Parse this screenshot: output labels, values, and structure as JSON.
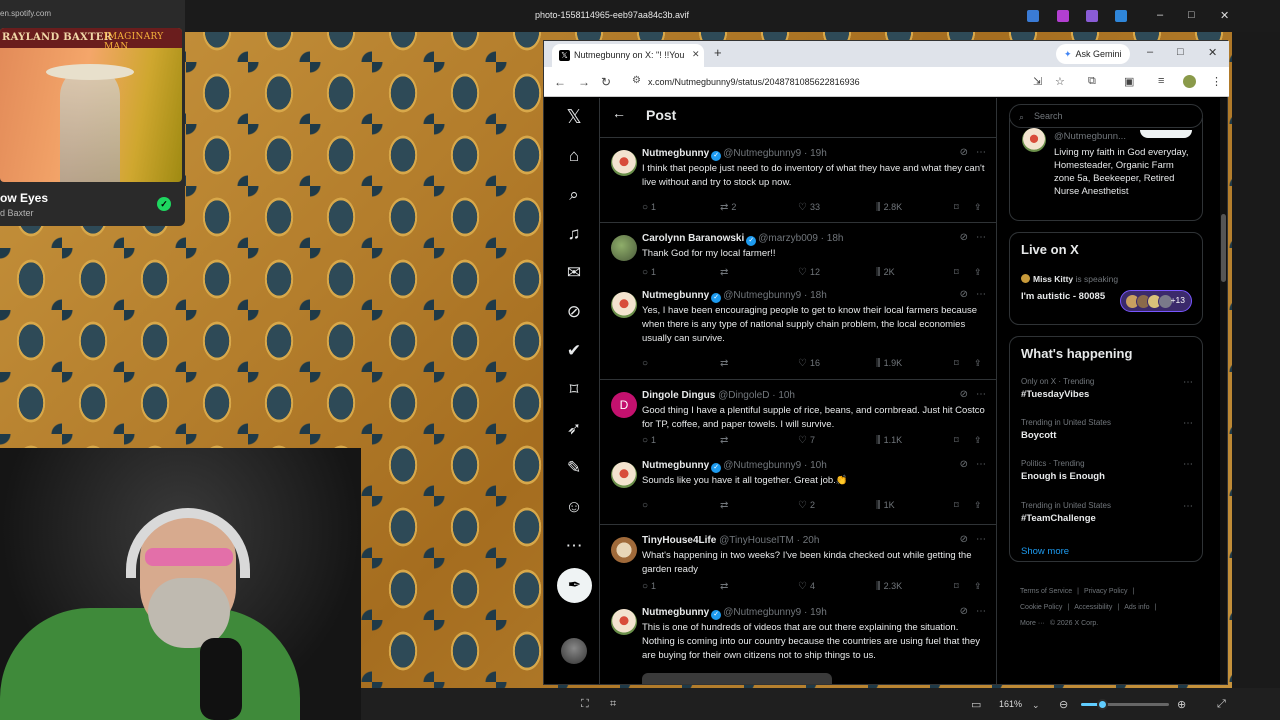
{
  "viewer": {
    "title": "photo-1558114965-eeb97aa84c3b.avif",
    "win_controls": [
      "–",
      "□",
      "✕"
    ],
    "zoom": "161%",
    "zoom_fraction": 0.24
  },
  "spotify": {
    "url": "en.spotify.com",
    "cover_artist": "RAYLAND BAXTER",
    "cover_album": "IMAGINARY MAN",
    "song": "ow Eyes",
    "artist": "d Baxter",
    "saved_icon": "check-icon"
  },
  "browser": {
    "tab_title": "Nutmegbunny on X: \"! !!You h",
    "tab_close": "✕",
    "new_tab": "+",
    "gemini_label": "Ask Gemini",
    "controls": [
      "–",
      "□",
      "✕"
    ],
    "url": "x.com/Nutmegbunny9/status/2048781085622816936"
  },
  "x": {
    "header_title": "Post",
    "tweets": [
      {
        "name": "Nutmegbunny",
        "handle": "@Nutmegbunny9",
        "time": "19h",
        "text": "I think that people just need to do inventory of what they have and what they can't live without and try to stock up now.",
        "replies": "1",
        "reposts": "2",
        "likes": "33",
        "views": "2.8K"
      },
      {
        "name": "Carolynn Baranowski",
        "handle": "@marzyb009",
        "time": "18h",
        "text": "Thank God for my local farmer!!",
        "replies": "1",
        "reposts": "",
        "likes": "12",
        "views": "2K"
      },
      {
        "name": "Nutmegbunny",
        "handle": "@Nutmegbunny9",
        "time": "18h",
        "text": "Yes, I have been encouraging people to get to know their local farmers because when there is any type of national supply chain problem, the local economies usually can  survive.",
        "replies": "",
        "reposts": "",
        "likes": "16",
        "views": "1.9K"
      },
      {
        "name": "Dingole Dingus",
        "handle": "@DingoleD",
        "time": "10h",
        "avatar_letter": "D",
        "text": "Good thing I have a plentiful supple of rice, beans, and cornbread. Just hit Costco for TP, coffee, and paper towels. I will survive.",
        "replies": "1",
        "reposts": "",
        "likes": "7",
        "views": "1.1K"
      },
      {
        "name": "Nutmegbunny",
        "handle": "@Nutmegbunny9",
        "time": "10h",
        "text": "Sounds like you have it all together. Great job.👏",
        "replies": "",
        "reposts": "",
        "likes": "2",
        "views": "1K"
      },
      {
        "name": "TinyHouse4Life",
        "handle": "@TinyHouseITM",
        "time": "20h",
        "text": "What's happening in two weeks? I've been kinda checked out while getting the garden ready",
        "replies": "1",
        "reposts": "",
        "likes": "4",
        "views": "2.3K"
      },
      {
        "name": "Nutmegbunny",
        "handle": "@Nutmegbunny9",
        "time": "19h",
        "text": "This is one of hundreds of videos that are out there explaining the situation. Nothing is coming into our country because the countries are using fuel that they are buying for their own citizens not to ship things to us."
      }
    ],
    "sidebar": {
      "search_placeholder": "Search",
      "bio_handle": "@Nutmegbunn...",
      "bio_text": "Living my faith in God everyday, Homesteader, Organic Farm zone 5a, Beekeeper, Retired Nurse Anesthetist",
      "live_title": "Live on X",
      "live_host": "Miss Kitty",
      "live_host_suffix": "is speaking",
      "live_space": "I'm autistic - 80085",
      "live_more": "+13",
      "happening_title": "What's happening",
      "trends": [
        {
          "context": "Only on X · Trending",
          "name": "#TuesdayVibes"
        },
        {
          "context": "Trending in United States",
          "name": "Boycott"
        },
        {
          "context": "Politics · Trending",
          "name": "Enough is Enough"
        },
        {
          "context": "Trending in United States",
          "name": "#TeamChallenge"
        }
      ],
      "show_more": "Show more",
      "footer": [
        "Terms of Service",
        "|",
        "Privacy Policy",
        "|",
        "Cookie Policy",
        "|",
        "Accessibility",
        "|",
        "Ads info",
        "|",
        "More ···",
        "© 2026 X Corp."
      ]
    }
  }
}
